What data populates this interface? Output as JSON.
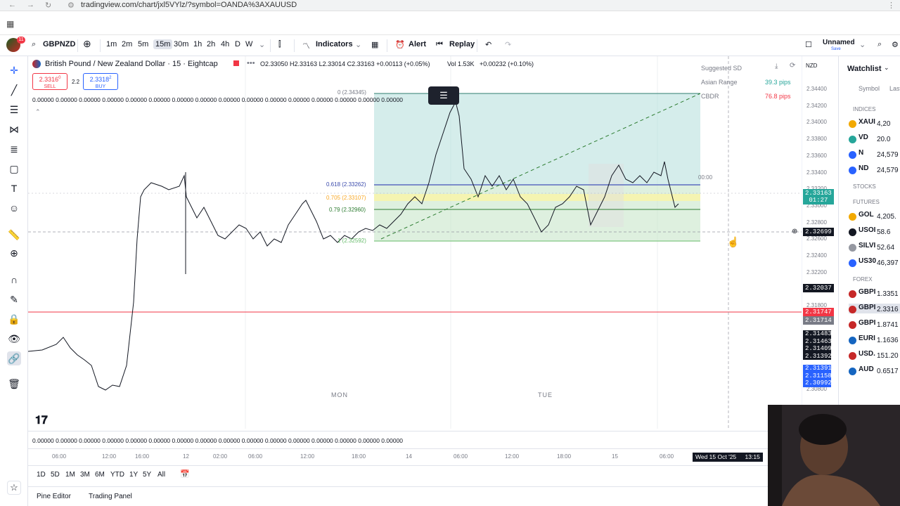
{
  "browser": {
    "url": "tradingview.com/chart/jxl5VYlz/?symbol=OANDA%3AXAUUSD"
  },
  "toolbar": {
    "symbol": "GBPNZD",
    "intervals": [
      "1m",
      "2m",
      "5m",
      "15m",
      "30m",
      "1h",
      "2h",
      "4h",
      "D",
      "W"
    ],
    "selected_interval": "15m",
    "indicators": "Indicators",
    "alert": "Alert",
    "replay": "Replay",
    "layout_name": "Unnamed",
    "layout_sub": "Save"
  },
  "legend": {
    "title": "British Pound / New Zealand Dollar · 15 · Eightcap",
    "ohlc": "O2.33050 H2.33163 L2.33014 C2.33163 +0.00113 (+0.05%)",
    "vol": "Vol 1.53K",
    "change": "+0.00232 (+0.10%)",
    "sell_price": "2.3316",
    "sell_sup": "0",
    "sell_label": "SELL",
    "spread": "2.2",
    "buy_price": "2.3318",
    "buy_sup": "2",
    "buy_label": "BUY",
    "zeros_row": "0.00000 0.00000 0.00000 0.00000 0.00000 0.00000 0.00000 0.00000 0.00000 0.00000 0.00000 0.00000 0.00000 0.00000 0.00000 0.00000",
    "bottom_zeros": "0.00000 0.00000 0.00000 0.00000 0.00000 0.00000 0.00000 0.00000 0.00000 0.00000 0.00000 0.00000 0.00000 0.00000 0.00000 0.00000"
  },
  "info_panel": {
    "suggested": "Suggested SD",
    "asian_label": "Asian Range",
    "asian_value": "39.3 pips",
    "cbdr_label": "CBDR",
    "cbdr_value": "76.8 pips",
    "currency": "NZD"
  },
  "fib": {
    "level0": "0 (2.34345)",
    "level618": "0.618 (2.33262)",
    "level705": "0.705 (2.33107)",
    "level79": "0.79 (2.32960)",
    "level1": "1 (2.32592)",
    "time_label": "00:00"
  },
  "price_axis": {
    "ticks": [
      "2.34400",
      "2.34200",
      "2.34000",
      "2.33800",
      "2.33600",
      "2.33400",
      "2.33200",
      "2.33000",
      "2.32800",
      "2.32600",
      "2.32400",
      "2.32200",
      "2.32000",
      "2.31800",
      "2.31600",
      "2.31400",
      "2.31200",
      "2.31000",
      "2.30800"
    ],
    "current": "2.33163",
    "countdown": "01:27",
    "crosshair": "2.32699",
    "level_a": "2.32037",
    "level_red": "2.31747",
    "level_b": "2.31714",
    "stack": [
      "2.31483",
      "2.31463",
      "2.31409",
      "2.31392"
    ],
    "blue_stack": [
      "2.31391",
      "2.31158",
      "2.30992"
    ]
  },
  "time_axis": {
    "labels": [
      "06:00",
      "12:00",
      "16:00",
      "12",
      "02:00",
      "06:00",
      "12:00",
      "18:00",
      "14",
      "06:00",
      "12:00",
      "18:00",
      "15",
      "06:00"
    ],
    "crosshair": "Wed 15 Oct '25",
    "crosshair_time": "13:15",
    "day_mon": "MON",
    "day_tue": "TUE"
  },
  "watchlist": {
    "title": "Watchlist",
    "col_symbol": "Symbol",
    "col_last": "Last",
    "sections": [
      "INDICES",
      "STOCKS",
      "FUTURES",
      "FOREX"
    ],
    "indices": [
      {
        "sym": "XAUI",
        "val": "4,20",
        "color": "#f2a900"
      },
      {
        "sym": "VD",
        "val": "20.0",
        "color": "#26a69a"
      },
      {
        "sym": "N",
        "val": "24,579",
        "color": "#2962ff"
      },
      {
        "sym": "ND",
        "val": "24,579",
        "color": "#2962ff"
      }
    ],
    "futures": [
      {
        "sym": "GOL",
        "val": "4,205.",
        "color": "#f2a900"
      },
      {
        "sym": "USOI",
        "val": "58.6",
        "color": "#131722"
      },
      {
        "sym": "SILVI",
        "val": "52.64",
        "color": "#9598a1"
      },
      {
        "sym": "US30",
        "val": "46,397",
        "color": "#2962ff"
      }
    ],
    "forex": [
      {
        "sym": "GBPI",
        "val": "1.3351",
        "color": "#c62828"
      },
      {
        "sym": "GBPI",
        "val": "2.3316",
        "color": "#c62828"
      },
      {
        "sym": "GBPI",
        "val": "1.8741",
        "color": "#c62828"
      },
      {
        "sym": "EURI",
        "val": "1.1636",
        "color": "#1565c0"
      },
      {
        "sym": "USD.",
        "val": "151.20",
        "color": "#c62828"
      },
      {
        "sym": "AUD",
        "val": "0.6517",
        "color": "#1565c0"
      }
    ]
  },
  "ranges": [
    "1D",
    "5D",
    "1M",
    "3M",
    "6M",
    "YTD",
    "1Y",
    "5Y",
    "All"
  ],
  "footer": {
    "pine": "Pine Editor",
    "panel": "Trading Panel"
  }
}
